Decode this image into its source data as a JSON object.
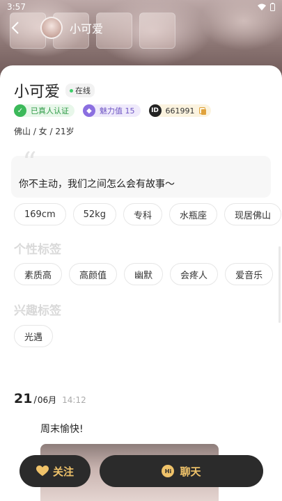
{
  "status_bar": {
    "time": "3:57"
  },
  "nav": {
    "title": "小可爱"
  },
  "profile": {
    "name": "小可爱",
    "online": "在线",
    "verified": "已真人认证",
    "charm": "魅力值 15",
    "id_label": "ID",
    "id_value": "661991",
    "basic_info": "佛山 / 女 / 21岁",
    "signature": "你不主动，我们之间怎么会有故事～"
  },
  "attributes": [
    "169cm",
    "52kg",
    "专科",
    "水瓶座",
    "现居佛山"
  ],
  "personal_tags": {
    "title": "个性标签",
    "items": [
      "素质高",
      "高颜值",
      "幽默",
      "会疼人",
      "爱音乐"
    ]
  },
  "interest_tags": {
    "title": "兴趣标签",
    "items": [
      "光遇"
    ]
  },
  "post": {
    "day": "21",
    "slash": "/",
    "month": "06月",
    "time": "14:12",
    "text": "周末愉快!"
  },
  "actions": {
    "follow": "关注",
    "chat": "聊天",
    "hi_badge": "Hi"
  },
  "colors": {
    "accent": "#f0c36a",
    "button_bg": "#2b2b2b",
    "online": "#3fcf6a",
    "verified": "#3cb95a",
    "charm": "#8b6fe0"
  }
}
